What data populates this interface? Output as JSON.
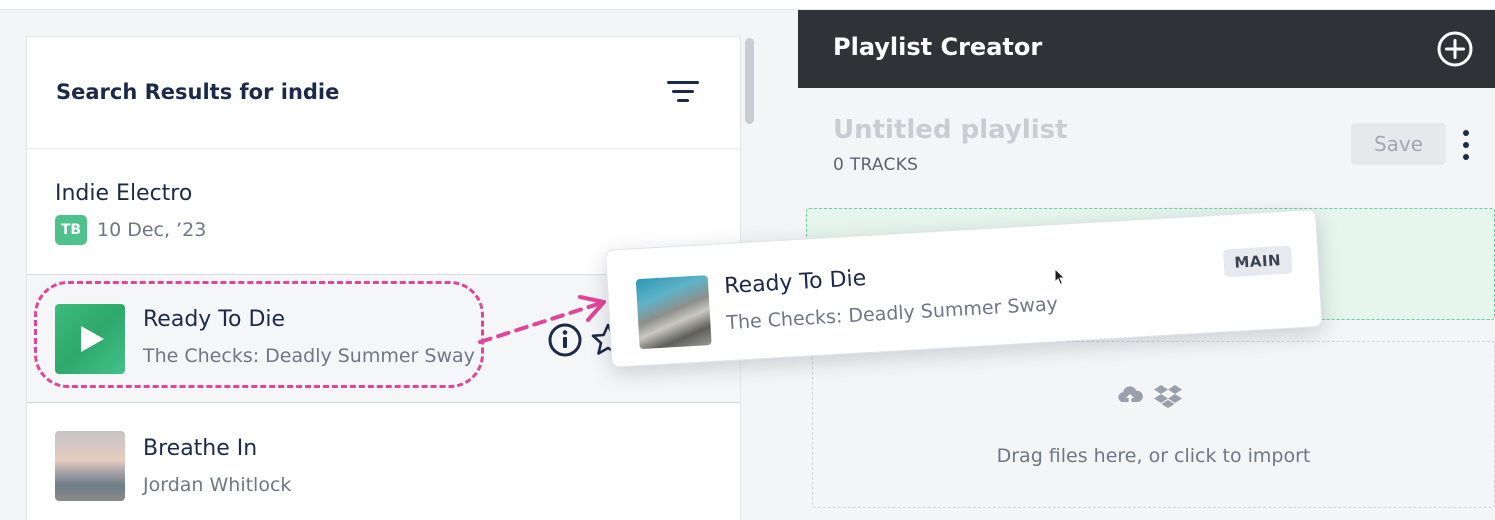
{
  "search": {
    "title": "Search Results for indie",
    "filter_icon": "filter-lines-icon"
  },
  "results": [
    {
      "kind": "playlist",
      "title": "Indie Electro",
      "owner_badge": "TB",
      "badge_color": "#4fc28b",
      "date": "10 Dec, ’23"
    },
    {
      "kind": "track",
      "title": "Ready To Die",
      "subtitle": "The Checks: Deadly Summer Sway",
      "thumb_icon": "play-icon",
      "actions": [
        "info-icon",
        "star-icon"
      ]
    },
    {
      "kind": "track",
      "title": "Breathe In",
      "subtitle": "Jordan Whitlock"
    }
  ],
  "drag": {
    "title": "Ready To Die",
    "subtitle": "The Checks: Deadly Summer Sway",
    "badge": "MAIN",
    "highlight_color": "#e0459b"
  },
  "creator": {
    "title": "Playlist Creator",
    "add_icon": "plus-circle-icon",
    "playlist_name": "Untitled playlist",
    "track_count": "0 TRACKS",
    "save_label": "Save",
    "more_icon": "kebab-menu-icon",
    "import_text": "Drag files here, or click to import",
    "import_icons": [
      "cloud-upload-icon",
      "dropbox-icon"
    ]
  },
  "colors": {
    "header_bg": "#2f3338",
    "accent_green": "#4fc28b",
    "drop_zone": "#e6f5ee"
  }
}
